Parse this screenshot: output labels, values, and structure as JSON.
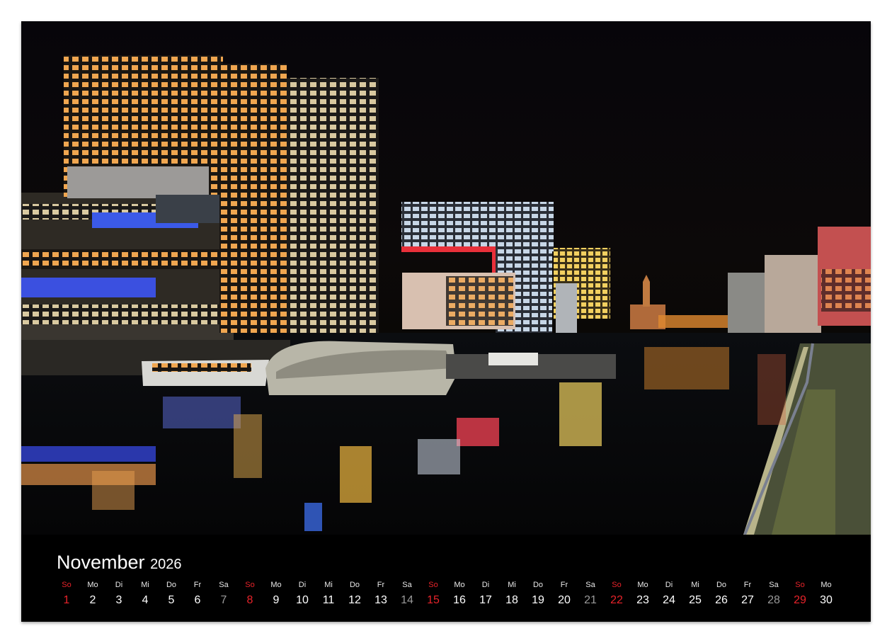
{
  "calendar": {
    "month": "November",
    "year": "2026",
    "colors": {
      "sunday": "#e8232a",
      "saturday": "#9a9a9a",
      "weekday": "#ffffff"
    },
    "days": [
      {
        "dow": "So",
        "num": "1"
      },
      {
        "dow": "Mo",
        "num": "2"
      },
      {
        "dow": "Di",
        "num": "3"
      },
      {
        "dow": "Mi",
        "num": "4"
      },
      {
        "dow": "Do",
        "num": "5"
      },
      {
        "dow": "Fr",
        "num": "6"
      },
      {
        "dow": "Sa",
        "num": "7"
      },
      {
        "dow": "So",
        "num": "8"
      },
      {
        "dow": "Mo",
        "num": "9"
      },
      {
        "dow": "Di",
        "num": "10"
      },
      {
        "dow": "Mi",
        "num": "11"
      },
      {
        "dow": "Do",
        "num": "12"
      },
      {
        "dow": "Fr",
        "num": "13"
      },
      {
        "dow": "Sa",
        "num": "14"
      },
      {
        "dow": "So",
        "num": "15"
      },
      {
        "dow": "Mo",
        "num": "16"
      },
      {
        "dow": "Di",
        "num": "17"
      },
      {
        "dow": "Mi",
        "num": "18"
      },
      {
        "dow": "Do",
        "num": "19"
      },
      {
        "dow": "Fr",
        "num": "20"
      },
      {
        "dow": "Sa",
        "num": "21"
      },
      {
        "dow": "So",
        "num": "22"
      },
      {
        "dow": "Mo",
        "num": "23"
      },
      {
        "dow": "Di",
        "num": "24"
      },
      {
        "dow": "Mi",
        "num": "25"
      },
      {
        "dow": "Do",
        "num": "26"
      },
      {
        "dow": "Fr",
        "num": "27"
      },
      {
        "dow": "Sa",
        "num": "28"
      },
      {
        "dow": "So",
        "num": "29"
      },
      {
        "dow": "Mo",
        "num": "30"
      }
    ]
  }
}
